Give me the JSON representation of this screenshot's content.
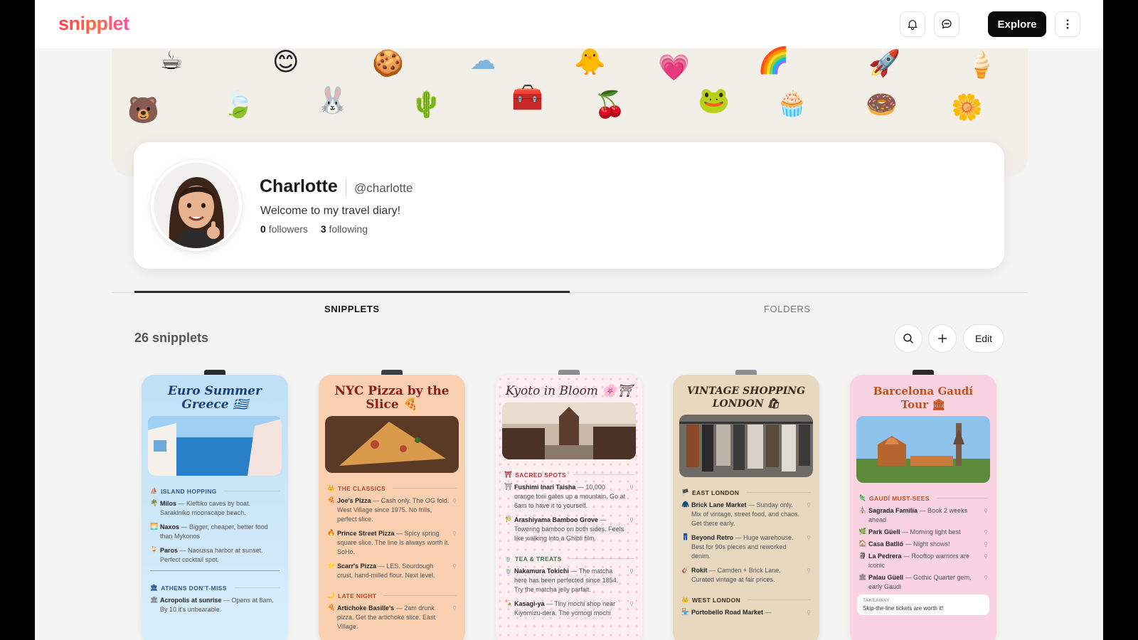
{
  "app": {
    "logo": "snipplet",
    "explore_label": "Explore"
  },
  "header_icons": [
    "bell-icon",
    "chat-bubble-icon",
    "more-vertical-icon"
  ],
  "banner_stickers": [
    "☕",
    "🐻",
    "😊",
    "🍃",
    "🍪",
    "🐰",
    "☁",
    "🌵",
    "🧰",
    "🐥",
    "🍒",
    "💗",
    "🐸",
    "🌈",
    "🧁",
    "🚀",
    "🍩",
    "🍦",
    "🌼"
  ],
  "profile": {
    "name": "Charlotte",
    "handle": "@charlotte",
    "bio": "Welcome to my travel diary!",
    "followers_count": "0",
    "followers_label": "followers",
    "following_count": "3",
    "following_label": "following"
  },
  "tabs": [
    {
      "label": "SNIPPLETS",
      "active": true
    },
    {
      "label": "FOLDERS",
      "active": false
    }
  ],
  "toolbar": {
    "count_label": "26 snipplets",
    "edit_label": "Edit"
  },
  "cards": [
    {
      "title": "Euro Summer Greece 🇬🇷",
      "bg": "#c9e6f7",
      "title_color": "#1a3f7a",
      "clip": "#2b2b2b",
      "sections": [
        {
          "label": "ISLAND HOPPING",
          "icon": "⛵",
          "color": "#2d5b8a",
          "items": [
            {
              "name": "Milos",
              "desc": " — Kleftiko caves by boat. Sarakiniko moonscape beach.",
              "bullet": "🌴"
            },
            {
              "name": "Naxos",
              "desc": " — Bigger, cheaper, better food than Mykonos",
              "bullet": "🌅"
            },
            {
              "name": "Paros",
              "desc": " — Naoussa harbor at sunset. Perfect cocktail spot.",
              "bullet": "🍹"
            }
          ]
        },
        {
          "label": "ATHENS DON'T-MISS",
          "icon": "🏛",
          "color": "#2d5b8a",
          "items": [
            {
              "name": "Acropolis at sunrise",
              "desc": " — Opens at 8am. By 10 it's unbearable.",
              "bullet": "🏛"
            }
          ]
        }
      ]
    },
    {
      "title": "NYC Pizza by the Slice 🍕",
      "bg": "#fbd2b5",
      "title_color": "#8a1c1c",
      "clip": "#3a3f47",
      "sections": [
        {
          "label": "THE CLASSICS",
          "icon": "👑",
          "color": "#c4452a",
          "items": [
            {
              "name": "Joe's Pizza",
              "desc": " — Cash only. The OG fold. West Village since 1975. No frills, perfect slice.",
              "bullet": "🍕"
            },
            {
              "name": "Prince Street Pizza",
              "desc": " — Spicy spring square slice. The line is always worth it. SoHo.",
              "bullet": "🔥"
            },
            {
              "name": "Scarr's Pizza",
              "desc": " — LES. Sourdough crust, hand-milled flour. Next level.",
              "bullet": "⭐"
            }
          ]
        },
        {
          "label": "LATE NIGHT",
          "icon": "🌙",
          "color": "#c4452a",
          "items": [
            {
              "name": "Artichoke Basille's",
              "desc": " — 2am drunk pizza. Get the artichoke slice. East Village.",
              "bullet": "🍕"
            }
          ]
        }
      ]
    },
    {
      "title": "Kyoto in Bloom 🌸⛩",
      "bg": "#fdeef1",
      "title_color": "#4a2a2a",
      "clip": "#8c8f94",
      "sections": [
        {
          "label": "SACRED SPOTS",
          "icon": "⛩",
          "color": "#b33a3a",
          "items": [
            {
              "name": "Fushimi Inari Taisha",
              "desc": " — 10,000 orange torii gates up a mountain. Go at 6am to have it to yourself.",
              "bullet": "⛩"
            },
            {
              "name": "Arashiyama Bamboo Grove",
              "desc": " — Towering bamboo on both sides. Feels like walking into a Ghibli film.",
              "bullet": "🎋"
            }
          ]
        },
        {
          "label": "TEA & TREATS",
          "icon": "🍵",
          "color": "#3c7a4a",
          "items": [
            {
              "name": "Nakamura Tokichi",
              "desc": " — The matcha here has been perfected since 1854. Try the matcha jelly parfait.",
              "bullet": "🍵"
            },
            {
              "name": "Kasagi-ya",
              "desc": " — Tiny mochi shop near Kiyomizu-dera. The yomogi mochi",
              "bullet": "🍡"
            }
          ]
        }
      ]
    },
    {
      "title": "VINTAGE SHOPPING LONDON 🛍",
      "bg": "#e9d9c2",
      "title_color": "#3a2a1a",
      "clip": "#8c8f94",
      "sections": [
        {
          "label": "EAST LONDON",
          "icon": "🏴",
          "color": "#3a2a1a",
          "items": [
            {
              "name": "Brick Lane Market",
              "desc": " — Sunday only. Mix of vintage, street food, and chaos. Get there early.",
              "bullet": "🧥"
            },
            {
              "name": "Beyond Retro",
              "desc": " — Huge warehouse. Best for 90s pieces and reworked denim.",
              "bullet": "👖"
            },
            {
              "name": "Rokit",
              "desc": " — Camden + Brick Lane. Curated vintage at fair prices.",
              "bullet": "🎸"
            }
          ]
        },
        {
          "label": "WEST LONDON",
          "icon": "👑",
          "color": "#3a2a1a",
          "items": [
            {
              "name": "Portobello Road Market",
              "desc": " —",
              "bullet": "🏪"
            }
          ]
        }
      ]
    },
    {
      "title": "Barcelona Gaudí Tour 🏛",
      "bg": "#f9d3e2",
      "title_color": "#c2521d",
      "clip": "#2b2b2b",
      "sections": [
        {
          "label": "GAUDÍ MUST-SEES",
          "icon": "🦎",
          "color": "#c2521d",
          "items": [
            {
              "name": "Sagrada Familia",
              "desc": " — Book 2 weeks ahead",
              "bullet": "⛪"
            },
            {
              "name": "Park Güell",
              "desc": " — Morning light best",
              "bullet": "🌿"
            },
            {
              "name": "Casa Batlló",
              "desc": " — Night shows!",
              "bullet": "🏠"
            },
            {
              "name": "La Pedrera",
              "desc": " — Rooftop warriors are iconic",
              "bullet": "🗿"
            },
            {
              "name": "Palau Güell",
              "desc": " — Gothic Quarter gem, early Gaudi",
              "bullet": "🏛"
            }
          ]
        }
      ],
      "takeaway": {
        "label": "TAKEAWAY",
        "text": "Skip-the-line tickets are worth it!"
      }
    }
  ]
}
